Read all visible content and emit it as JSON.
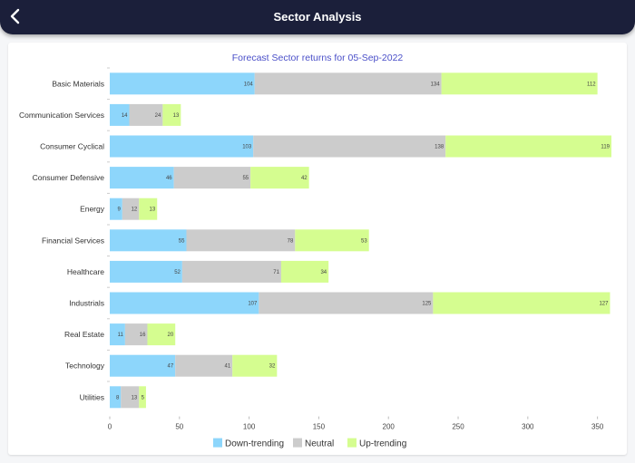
{
  "header": {
    "title": "Sector Analysis",
    "back_icon": "chevron-left-icon"
  },
  "colors": {
    "down": "#8dd6fb",
    "neutral": "#cccccc",
    "up": "#d5fd90",
    "title": "#4a4fc8",
    "header_bg": "#1b1f3a"
  },
  "chart_data": {
    "type": "bar",
    "orientation": "horizontal",
    "stacked": true,
    "title": "Forecast Sector returns for 05-Sep-2022",
    "xlabel": "",
    "ylabel": "",
    "xlim": [
      0,
      360
    ],
    "x_ticks": [
      0,
      50,
      100,
      150,
      200,
      250,
      300,
      350
    ],
    "legend_position": "bottom",
    "categories": [
      "Basic Materials",
      "Communication Services",
      "Consumer Cyclical",
      "Consumer Defensive",
      "Energy",
      "Financial Services",
      "Healthcare",
      "Industrials",
      "Real Estate",
      "Technology",
      "Utilities"
    ],
    "series": [
      {
        "name": "Down-trending",
        "color": "#8dd6fb",
        "values": [
          104,
          14,
          103,
          46,
          9,
          55,
          52,
          107,
          11,
          47,
          8
        ]
      },
      {
        "name": "Neutral",
        "color": "#cccccc",
        "values": [
          134,
          24,
          138,
          55,
          12,
          78,
          71,
          125,
          16,
          41,
          13
        ]
      },
      {
        "name": "Up-trending",
        "color": "#d5fd90",
        "values": [
          112,
          13,
          119,
          42,
          13,
          53,
          34,
          127,
          20,
          32,
          5
        ]
      }
    ]
  }
}
